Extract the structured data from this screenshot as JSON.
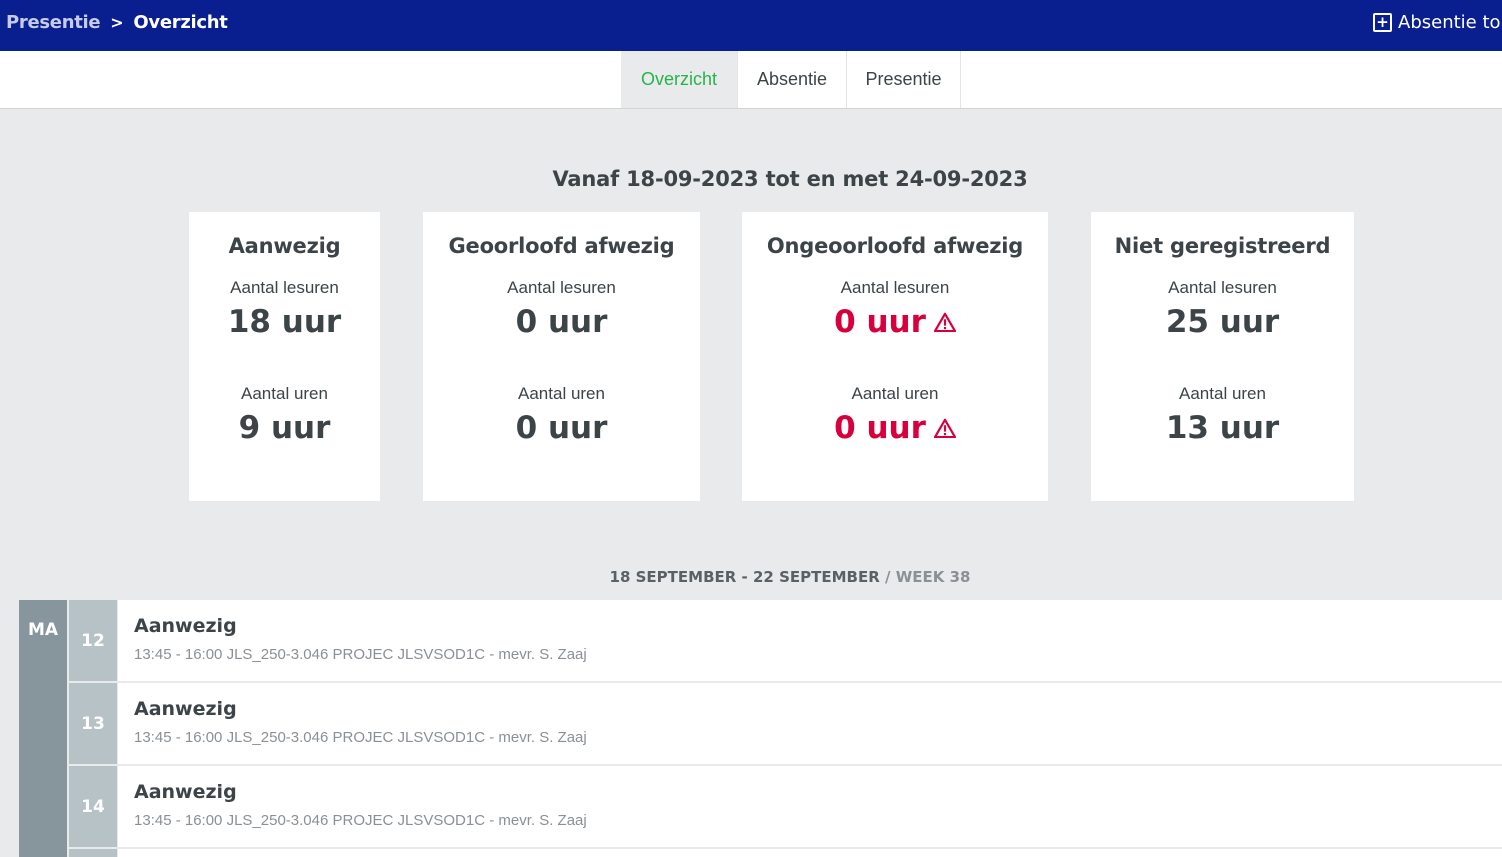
{
  "header": {
    "breadcrumb": [
      "Presentie",
      "Overzicht"
    ],
    "breadcrumb_separator": ">",
    "absentie_button": "Absentie to",
    "plus_icon": "+"
  },
  "tabs": [
    {
      "label": "Overzicht",
      "active": true
    },
    {
      "label": "Absentie",
      "active": false
    },
    {
      "label": "Presentie",
      "active": false
    }
  ],
  "range_text": "Vanaf 18-09-2023 tot en met 24-09-2023",
  "cards": [
    {
      "title": "Aanwezig",
      "label1": "Aantal lesuren",
      "value1": "18 uur",
      "label2": "Aantal uren",
      "value2": "9 uur",
      "warning": false
    },
    {
      "title": "Geoorloofd afwezig",
      "label1": "Aantal lesuren",
      "value1": "0 uur",
      "label2": "Aantal uren",
      "value2": "0 uur",
      "warning": false
    },
    {
      "title": "Ongeoorloofd afwezig",
      "label1": "Aantal lesuren",
      "value1": "0 uur",
      "label2": "Aantal uren",
      "value2": "0 uur",
      "warning": true
    },
    {
      "title": "Niet geregistreerd",
      "label1": "Aantal lesuren",
      "value1": "25 uur",
      "label2": "Aantal uren",
      "value2": "13 uur",
      "warning": false
    }
  ],
  "week": {
    "range": "18 SEPTEMBER - 22 SEPTEMBER",
    "divider": " / ",
    "label": "WEEK 38"
  },
  "schedule": {
    "day": "MA",
    "rows": [
      {
        "hour": "12",
        "status": "Aanwezig",
        "details": "13:45 - 16:00 JLS_250-3.046 PROJEC JLSVSOD1C - mevr. S. Zaaj"
      },
      {
        "hour": "13",
        "status": "Aanwezig",
        "details": "13:45 - 16:00 JLS_250-3.046 PROJEC JLSVSOD1C - mevr. S. Zaaj"
      },
      {
        "hour": "14",
        "status": "Aanwezig",
        "details": "13:45 - 16:00 JLS_250-3.046 PROJEC JLSVSOD1C - mevr. S. Zaaj"
      }
    ]
  },
  "colors": {
    "header_bg": "#0a1f8f",
    "active_tab": "#27b44a",
    "danger": "#d8003c",
    "day_column": "#86969c",
    "hour_cell": "#b7c2c6"
  }
}
